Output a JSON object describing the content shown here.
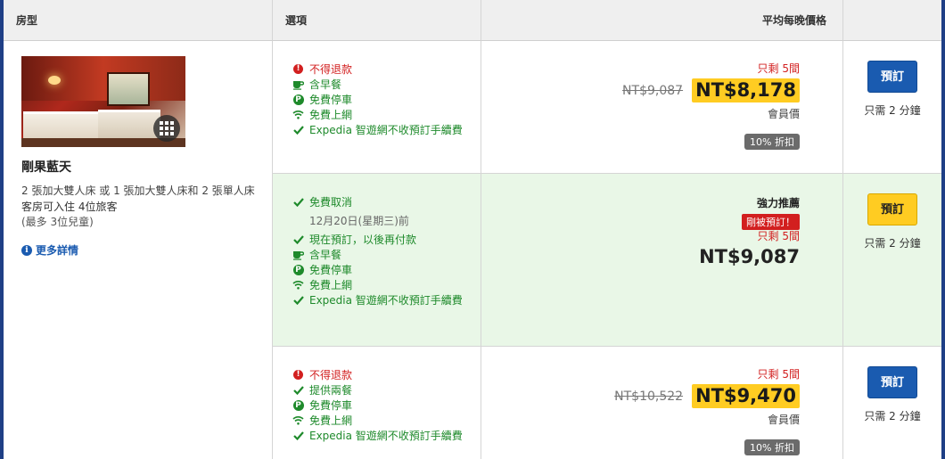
{
  "header": {
    "room_type": "房型",
    "options": "選項",
    "avg_price": "平均每晚價格",
    "action": ""
  },
  "room": {
    "name": "剛果藍天",
    "beds": "2 張加大雙人床 或 1 張加大雙人床和 2 張單人床",
    "occupancy": "客房可入住 4位旅客",
    "children": "(最多 3位兒童)",
    "more": "更多詳情"
  },
  "rates": [
    {
      "features": [
        {
          "icon": "alert-icon",
          "text": "不得退款",
          "style": "red"
        },
        {
          "icon": "coffee-icon",
          "text": "含早餐",
          "style": "green"
        },
        {
          "icon": "parking-icon",
          "text": "免費停車",
          "style": "green"
        },
        {
          "icon": "wifi-icon",
          "text": "免費上網",
          "style": "green"
        },
        {
          "icon": "check-icon",
          "text": "Expedia 智遊網不收預訂手續費",
          "style": "green"
        }
      ],
      "left": "只剩 5間",
      "original_price": "NT$9,087",
      "price": "NT$8,178",
      "member": "會員價",
      "discount": "10% 折扣",
      "button": "預訂",
      "need": "只需 2 分鐘"
    },
    {
      "features": [
        {
          "icon": "check-icon",
          "text": "免費取消",
          "style": "green"
        },
        {
          "icon": "",
          "text": "12月20日(星期三)前",
          "style": "gray"
        },
        {
          "icon": "check-icon",
          "text": "現在預訂，以後再付款",
          "style": "green"
        },
        {
          "icon": "coffee-icon",
          "text": "含早餐",
          "style": "green"
        },
        {
          "icon": "parking-icon",
          "text": "免費停車",
          "style": "green"
        },
        {
          "icon": "wifi-icon",
          "text": "免費上網",
          "style": "green"
        },
        {
          "icon": "check-icon",
          "text": "Expedia 智遊網不收預訂手續費",
          "style": "green"
        }
      ],
      "recommend": "強力推薦",
      "hot": "剛被預訂！",
      "left": "只剩 5間",
      "price": "NT$9,087",
      "button": "預訂",
      "need": "只需 2 分鐘"
    },
    {
      "features": [
        {
          "icon": "alert-icon",
          "text": "不得退款",
          "style": "red"
        },
        {
          "icon": "check-icon",
          "text": "提供兩餐",
          "style": "green"
        },
        {
          "icon": "parking-icon",
          "text": "免費停車",
          "style": "green"
        },
        {
          "icon": "wifi-icon",
          "text": "免費上網",
          "style": "green"
        },
        {
          "icon": "check-icon",
          "text": "Expedia 智遊網不收預訂手續費",
          "style": "green"
        }
      ],
      "left": "只剩 5間",
      "original_price": "NT$10,522",
      "price": "NT$9,470",
      "member": "會員價",
      "discount": "10% 折扣",
      "button": "預訂",
      "need": "只需 2 分鐘"
    }
  ],
  "colors": {
    "accent_blue": "#1a5bb0",
    "highlight_green": "#e9f7e7",
    "deal_yellow": "#ffcc22",
    "alert_red": "#d21f1f",
    "feature_green": "#1e8a2b"
  }
}
